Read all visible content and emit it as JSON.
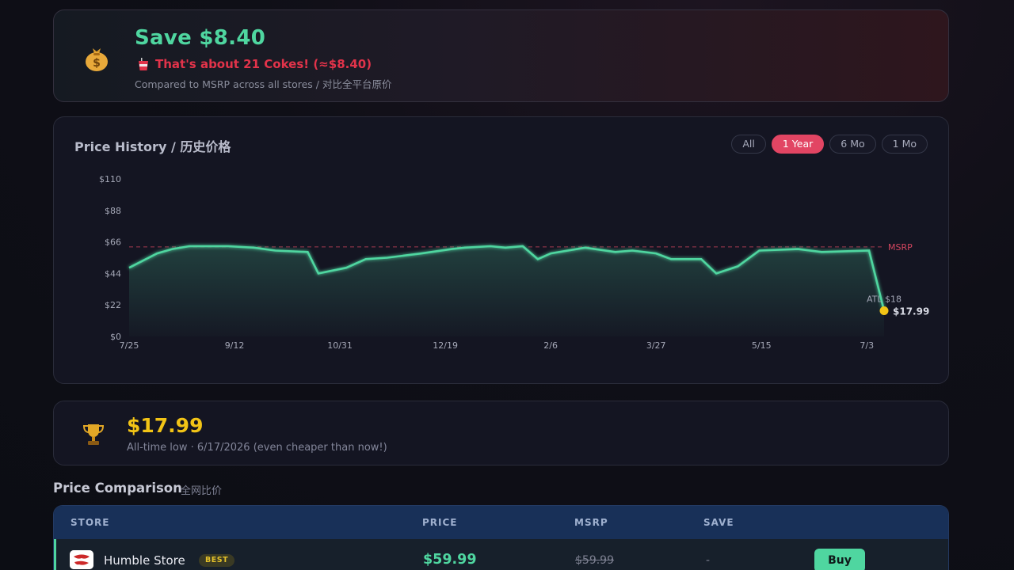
{
  "savings": {
    "icon": "money-bag-icon",
    "title": "Save $8.40",
    "coke_text": "That's about 21 Cokes! (≈$8.40)",
    "note": "Compared to MSRP across all stores / 对比全平台原价",
    "colors": {
      "title": "#4fd6a0",
      "coke": "#e2334a"
    }
  },
  "history": {
    "title": "Price History / 历史价格",
    "ranges": [
      "All",
      "1 Year",
      "6 Mo",
      "1 Mo"
    ],
    "active_range": "1 Year"
  },
  "chart_data": {
    "type": "line",
    "x_tick_labels": [
      "7/25",
      "9/12",
      "10/31",
      "12/19",
      "2/6",
      "3/27",
      "5/15",
      "7/3"
    ],
    "y_tick_labels": [
      "$0",
      "$22",
      "$44",
      "$66",
      "$88",
      "$110"
    ],
    "ylim": [
      0,
      110
    ],
    "x_days_range": [
      0,
      351
    ],
    "msrp": {
      "label": "MSRP",
      "value": 62.5
    },
    "atl_label": "ATL $18",
    "current_label": "$17.99",
    "series": [
      {
        "x": [
          0,
          13,
          20,
          28,
          46,
          58,
          68,
          83,
          88,
          101,
          110,
          120,
          136,
          150,
          156,
          168,
          175,
          183,
          190,
          196,
          212,
          226,
          234,
          245,
          252,
          266,
          273,
          283,
          293,
          311,
          322,
          344,
          351
        ],
        "y": [
          48,
          58,
          61,
          63,
          63,
          62,
          60,
          59,
          44,
          48,
          54,
          55,
          58,
          61,
          62,
          63,
          62,
          63,
          54,
          58,
          62,
          59,
          60,
          58,
          54,
          54,
          44,
          49,
          60,
          61,
          59,
          60,
          17.99
        ]
      }
    ],
    "colors": {
      "line": "#4fd6a0",
      "msrp": "#d3465f",
      "current": "#f2c416"
    }
  },
  "atl": {
    "icon": "trophy-icon",
    "price": "$17.99",
    "note": "All-time low · 6/17/2026 (even cheaper than now!)"
  },
  "comparison": {
    "title": "Price Comparison",
    "subtitle": "全网比价",
    "headers": [
      "STORE",
      "PRICE",
      "MSRP",
      "SAVE"
    ],
    "rows": [
      {
        "store": "Humble Store",
        "badge": "BEST",
        "price": "$59.99",
        "msrp": "$59.99",
        "save": "-",
        "action": "Buy"
      }
    ]
  }
}
